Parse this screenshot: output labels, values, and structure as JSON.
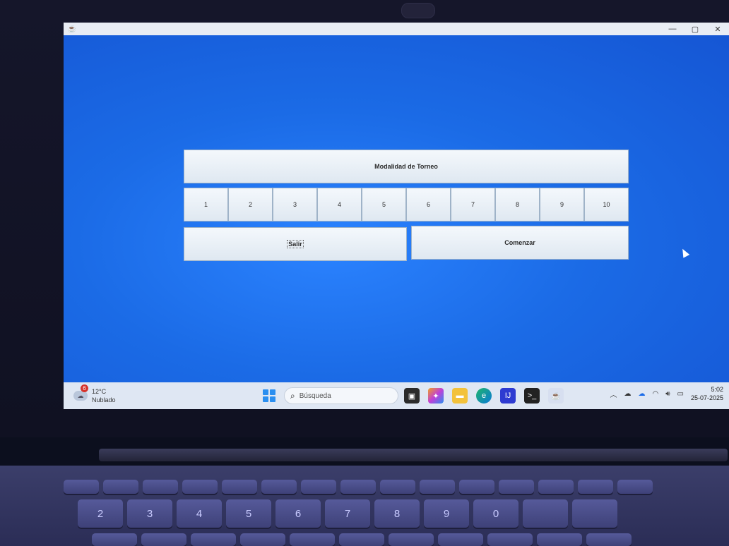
{
  "window": {
    "title": "",
    "controls": {
      "minimize": "—",
      "maximize": "▢",
      "close": "✕"
    }
  },
  "app": {
    "title_button": "Modalidad de Torneo",
    "numbers": [
      "1",
      "2",
      "3",
      "4",
      "5",
      "6",
      "7",
      "8",
      "9",
      "10"
    ],
    "exit_button": "Salir",
    "start_button": "Comenzar"
  },
  "taskbar": {
    "weather": {
      "badge": "6",
      "temperature": "12°C",
      "condition": "Nublado"
    },
    "search_placeholder": "Búsqueda",
    "clock": {
      "time": "5:02",
      "date": "25-07-2025"
    }
  },
  "keyboard": {
    "number_keys": [
      "2",
      "3",
      "4",
      "5",
      "6",
      "7",
      "8",
      "9",
      "0"
    ]
  }
}
